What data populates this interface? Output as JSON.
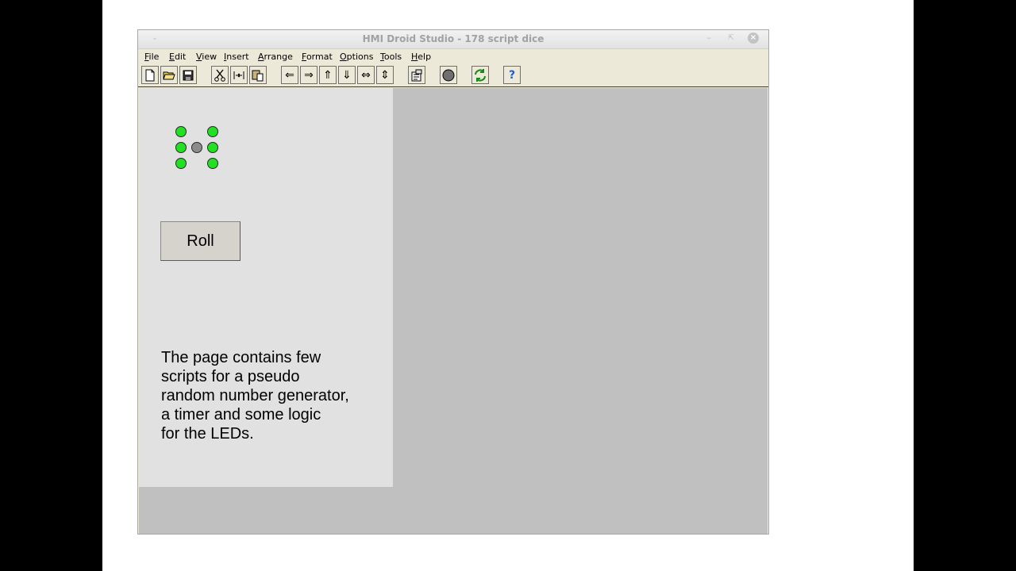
{
  "window": {
    "title": "HMI Droid Studio - 178 script dice"
  },
  "menu": [
    {
      "label": "File"
    },
    {
      "label": "Edit"
    },
    {
      "label": "View"
    },
    {
      "label": "Insert"
    },
    {
      "label": "Arrange"
    },
    {
      "label": "Format"
    },
    {
      "label": "Options"
    },
    {
      "label": "Tools"
    },
    {
      "label": "Help"
    }
  ],
  "toolbar": {
    "help_glyph": "?"
  },
  "dice": {
    "leds": [
      "on",
      "on",
      "on",
      "off",
      "on",
      "on",
      "on"
    ],
    "on_color": "#22e022",
    "off_color": "#8c8c8c"
  },
  "roll_button": {
    "label": "Roll"
  },
  "description": {
    "lines": [
      "The page contains few",
      "scripts for a pseudo",
      "random number generator,",
      "a timer and some logic",
      "for the LEDs."
    ]
  }
}
